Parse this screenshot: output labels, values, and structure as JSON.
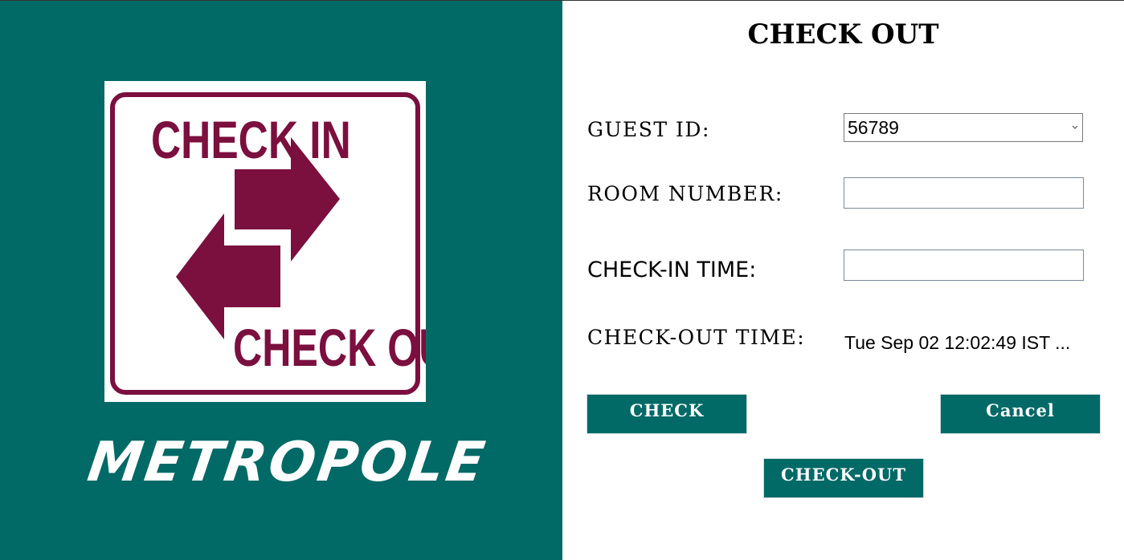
{
  "brand": {
    "logo_text_top": "CHECK IN",
    "logo_text_bottom": "CHECK OUT",
    "name": "METROPOLE"
  },
  "colors": {
    "panel": "#016966",
    "logo_maroon": "#7b0f3e",
    "button": "#016966"
  },
  "form": {
    "title": "CHECK OUT",
    "guest_id_label": "GUEST ID:",
    "guest_id_value": "56789",
    "room_number_label": "ROOM NUMBER:",
    "room_number_value": "",
    "checkin_time_label": "CHECK-IN TIME:",
    "checkin_time_value": "",
    "checkout_time_label": "CHECK-OUT TIME:",
    "checkout_time_value": "Tue Sep 02 12:02:49 IST ...",
    "icons": {
      "dropdown": "chevron-down-icon"
    }
  },
  "buttons": {
    "check": "CHECK",
    "cancel": "Cancel",
    "checkout": "CHECK-OUT"
  }
}
